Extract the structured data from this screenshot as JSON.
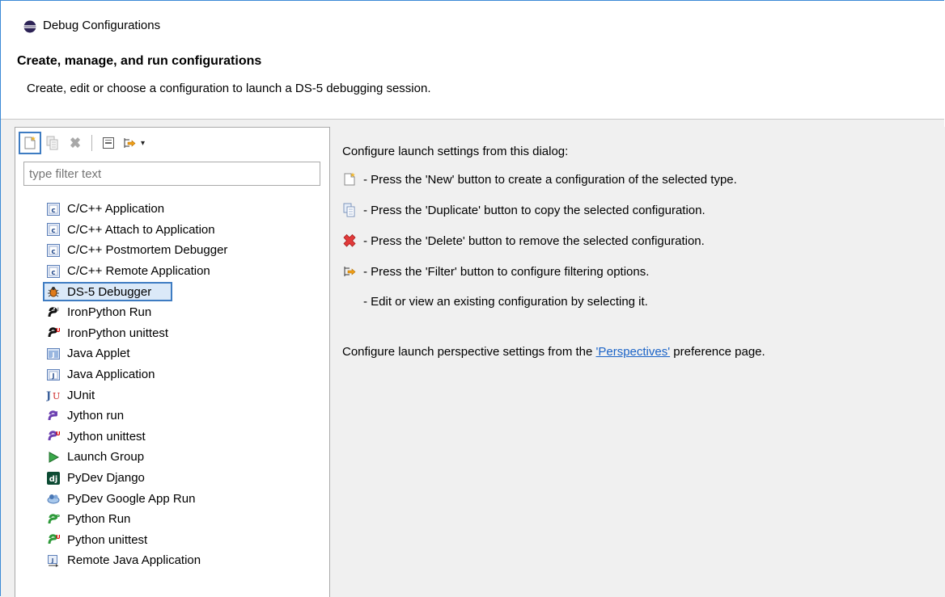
{
  "window": {
    "title": "Debug Configurations"
  },
  "header": {
    "title": "Create, manage, and run configurations",
    "description": "Create, edit or choose a configuration to launch a DS-5 debugging session."
  },
  "toolbar": {
    "buttons": [
      {
        "name": "new-configuration",
        "icon": "new-config-icon"
      },
      {
        "name": "duplicate",
        "icon": "duplicate-icon"
      },
      {
        "name": "delete",
        "icon": "delete-icon"
      },
      {
        "name": "collapse-all",
        "icon": "collapse-all-icon"
      },
      {
        "name": "filter",
        "icon": "filter-icon"
      }
    ],
    "dropdown_glyph": "▾"
  },
  "filter": {
    "placeholder": "type filter text"
  },
  "tree": {
    "items": [
      {
        "label": "C/C++ Application",
        "icon": "c-icon"
      },
      {
        "label": "C/C++ Attach to Application",
        "icon": "c-icon"
      },
      {
        "label": "C/C++ Postmortem Debugger",
        "icon": "c-icon"
      },
      {
        "label": "C/C++ Remote Application",
        "icon": "c-icon"
      },
      {
        "label": "DS-5 Debugger",
        "icon": "ds5-bug-icon",
        "selected": true
      },
      {
        "label": "IronPython Run",
        "icon": "python-icon"
      },
      {
        "label": "IronPython unittest",
        "icon": "python-unittest-icon"
      },
      {
        "label": "Java Applet",
        "icon": "java-applet-icon"
      },
      {
        "label": "Java Application",
        "icon": "java-app-icon"
      },
      {
        "label": "JUnit",
        "icon": "junit-icon"
      },
      {
        "label": "Jython run",
        "icon": "jython-icon"
      },
      {
        "label": "Jython unittest",
        "icon": "jython-unittest-icon"
      },
      {
        "label": "Launch Group",
        "icon": "launch-group-icon"
      },
      {
        "label": "PyDev Django",
        "icon": "django-icon"
      },
      {
        "label": "PyDev Google App Run",
        "icon": "google-app-icon"
      },
      {
        "label": "Python Run",
        "icon": "python-run-icon"
      },
      {
        "label": "Python unittest",
        "icon": "python-unittest-icon"
      },
      {
        "label": "Remote Java Application",
        "icon": "remote-java-icon"
      }
    ]
  },
  "info": {
    "intro": "Configure launch settings from this dialog:",
    "new_hint": "- Press the 'New' button to create a configuration of the selected type.",
    "duplicate_hint": "- Press the 'Duplicate' button to copy the selected configuration.",
    "delete_hint": "- Press the 'Delete' button to remove the selected configuration.",
    "filter_hint": "- Press the 'Filter' button to configure filtering options.",
    "edit_hint": "- Edit or view an existing configuration by selecting it.",
    "perspective_prefix": "Configure launch perspective settings from the ",
    "perspective_link": "'Perspectives'",
    "perspective_suffix": " preference page."
  },
  "colors": {
    "accent": "#3e7cc2",
    "link": "#1a63c7",
    "panel_bg": "#f0f0f0"
  }
}
